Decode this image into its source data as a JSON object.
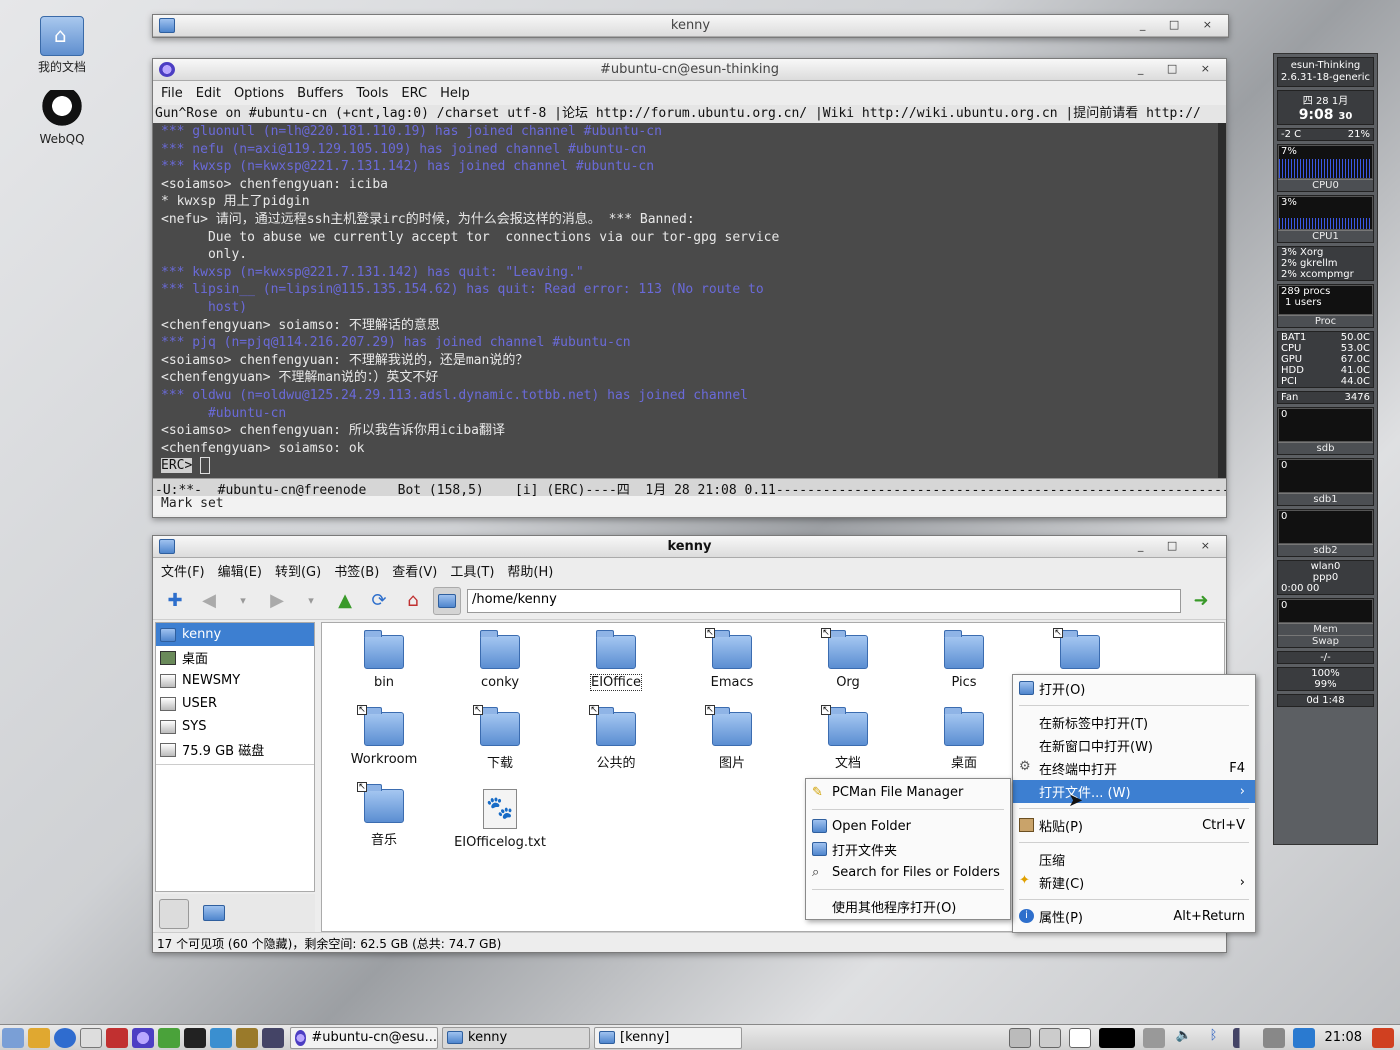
{
  "desktop": {
    "icons": [
      {
        "label": "我的文档",
        "icon": "home-folder-icon"
      },
      {
        "label": "WebQQ",
        "icon": "qq-penguin-icon"
      }
    ]
  },
  "kenny_top": {
    "title": "kenny"
  },
  "emacs": {
    "title": "#ubuntu-cn@esun-thinking",
    "menu": [
      "File",
      "Edit",
      "Options",
      "Buffers",
      "Tools",
      "ERC",
      "Help"
    ],
    "header": "Gun^Rose on #ubuntu-cn (+cnt,lag:0) /charset utf-8 |论坛 http://forum.ubuntu.org.cn/ |Wiki http://wiki.ubuntu.org.cn |提问前请看 http://",
    "lines": [
      {
        "t": "*** gluonull (n=lh@220.181.110.19) has joined channel #ubuntu-cn",
        "k": "sys"
      },
      {
        "t": "*** nefu (n=axi@119.129.105.109) has joined channel #ubuntu-cn",
        "k": "sys"
      },
      {
        "t": "*** kwxsp (n=kwxsp@221.7.131.142) has joined channel #ubuntu-cn",
        "k": "sys"
      },
      {
        "t": "<soiamso> chenfengyuan: iciba",
        "k": "msg"
      },
      {
        "t": "* kwxsp 用上了pidgin",
        "k": "msg"
      },
      {
        "t": "<nefu> 请问，通过远程ssh主机登录irc的时候，为什么会报这样的消息。 *** Banned:",
        "k": "msg"
      },
      {
        "t": "      Due to abuse we currently accept tor  connections via our tor-gpg service",
        "k": "msg"
      },
      {
        "t": "      only.",
        "k": "msg"
      },
      {
        "t": "*** kwxsp (n=kwxsp@221.7.131.142) has quit: \"Leaving.\"",
        "k": "sys"
      },
      {
        "t": "*** lipsin__ (n=lipsin@115.135.154.62) has quit: Read error: 113 (No route to",
        "k": "sys"
      },
      {
        "t": "      host)",
        "k": "sys"
      },
      {
        "t": "<chenfengyuan> soiamso: 不理解话的意思",
        "k": "msg"
      },
      {
        "t": "*** pjq (n=pjq@114.216.207.29) has joined channel #ubuntu-cn",
        "k": "sys"
      },
      {
        "t": "<soiamso> chenfengyuan: 不理解我说的，还是man说的？",
        "k": "msg"
      },
      {
        "t": "<chenfengyuan> 不理解man说的：）英文不好",
        "k": "msg"
      },
      {
        "t": "*** oldwu (n=oldwu@125.24.29.113.adsl.dynamic.totbb.net) has joined channel",
        "k": "sys"
      },
      {
        "t": "      #ubuntu-cn",
        "k": "sys"
      },
      {
        "t": "<soiamso> chenfengyuan: 所以我告诉你用iciba翻译",
        "k": "msg"
      },
      {
        "t": "<chenfengyuan> soiamso: ok",
        "k": "msg"
      }
    ],
    "prompt": "ERC>",
    "modeline": "-U:**-  #ubuntu-cn@freenode    Bot (158,5)    [i] (ERC)----四  1月 28 21:08 0.11--------------------------------------------------------------------------------",
    "echo": "Mark set"
  },
  "fm": {
    "title": "kenny",
    "menu": [
      "文件(F)",
      "编辑(E)",
      "转到(G)",
      "书签(B)",
      "查看(V)",
      "工具(T)",
      "帮助(H)"
    ],
    "path": "/home/kenny",
    "sidebar": [
      "kenny",
      "桌面",
      "NEWSMY",
      "USER",
      "SYS",
      "75.9 GB 磁盘"
    ],
    "files": [
      "bin",
      "conky",
      "EIOffice",
      "Emacs",
      "Org",
      "Pics",
      "",
      "Workroom",
      "下载",
      "公共的",
      "图片",
      "文档",
      "桌面",
      "视频",
      "音乐",
      "EIOfficelog.txt"
    ],
    "status": "17 个可见项 (60 个隐藏)，剩余空间: 62.5 GB (总共: 74.7 GB)"
  },
  "ctx": {
    "open": "打开(O)",
    "open_tab": "在新标签中打开(T)",
    "open_win": "在新窗口中打开(W)",
    "open_term": "在终端中打开",
    "open_term_acc": "F4",
    "open_with": "打开文件... (W)",
    "paste": "粘贴(P)",
    "paste_acc": "Ctrl+V",
    "compress": "压缩",
    "new": "新建(C)",
    "props": "属性(P)",
    "props_acc": "Alt+Return"
  },
  "sub": {
    "pcman": "PCMan File Manager",
    "open_folder": "Open Folder",
    "open_folder_cn": "打开文件夹",
    "search": "Search for Files or Folders",
    "other": "使用其他程序打开(O)"
  },
  "gk": {
    "host": "esun-Thinking",
    "kernel": "2.6.31-18-generic",
    "date": "四 28 1月",
    "time": "9:08",
    "sec": "30",
    "batt_l": "-2  C",
    "batt_r": "21%",
    "cpu0": "CPU0",
    "cpu0_pct": "7%",
    "cpu1": "CPU1",
    "cpu1_pct": "3%",
    "top1": "3% Xorg",
    "top2": "2% gkrellm",
    "top3": "2% xcompmgr",
    "procs": "289 procs",
    "users": "1  users",
    "proc": "Proc",
    "temps": [
      [
        "BAT1",
        "50.0C"
      ],
      [
        "CPU",
        "53.0C"
      ],
      [
        "GPU",
        "67.0C"
      ],
      [
        "HDD",
        "41.0C"
      ],
      [
        "PCI",
        "44.0C"
      ]
    ],
    "fan": "Fan",
    "fan_v": "3476",
    "sdb": "sdb",
    "sdb1": "sdb1",
    "sdb2": "sdb2",
    "zero": "0",
    "wlan": "wlan0",
    "ppp": "ppp0",
    "netclock": "0:00  00",
    "mem": "Mem",
    "swap": "Swap",
    "mail": "-/-",
    "p1": "100%",
    "p2": "99%",
    "uptime": "0d  1:48"
  },
  "taskbar": {
    "tasks": [
      "#ubuntu-cn@esu...",
      "kenny",
      "[kenny]"
    ],
    "clock": "21:08"
  }
}
